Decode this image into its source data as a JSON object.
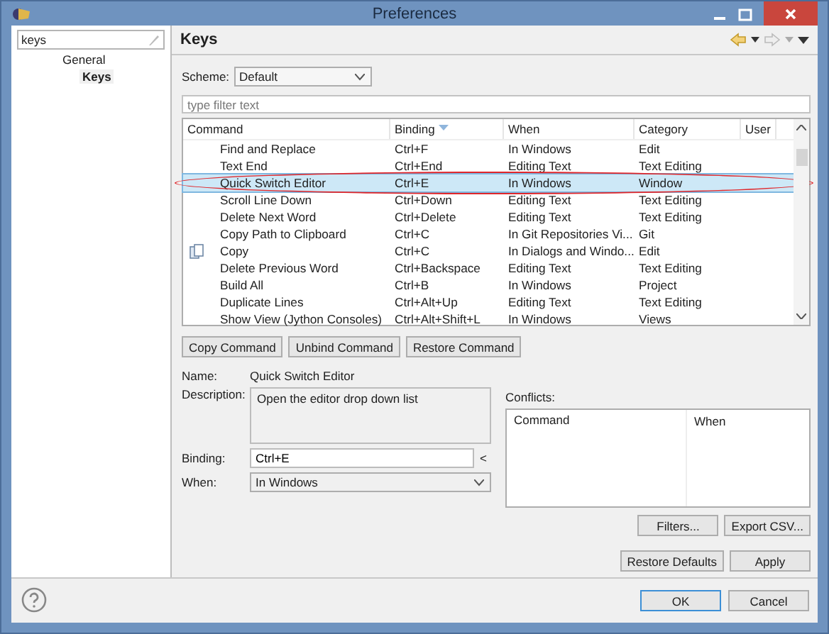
{
  "window": {
    "title": "Preferences"
  },
  "sidebar": {
    "filter": {
      "value": "keys"
    },
    "items": [
      {
        "label": "General",
        "selected": false,
        "children": [
          {
            "label": "Keys",
            "selected": true
          }
        ]
      }
    ]
  },
  "page": {
    "title": "Keys"
  },
  "scheme": {
    "label": "Scheme:",
    "value": "Default"
  },
  "filter": {
    "placeholder": "type filter text"
  },
  "table": {
    "columns": [
      "Command",
      "Binding",
      "When",
      "Category",
      "User"
    ],
    "rows": [
      {
        "kind": "plain",
        "selected": false,
        "circled": false,
        "cells": [
          "Find and Replace",
          "Ctrl+F",
          "In Windows",
          "Edit",
          ""
        ]
      },
      {
        "kind": "plain",
        "selected": false,
        "circled": false,
        "cells": [
          "Text End",
          "Ctrl+End",
          "Editing Text",
          "Text Editing",
          ""
        ]
      },
      {
        "kind": "plain",
        "selected": true,
        "circled": true,
        "cells": [
          "Quick Switch Editor",
          "Ctrl+E",
          "In Windows",
          "Window",
          ""
        ]
      },
      {
        "kind": "plain",
        "selected": false,
        "circled": false,
        "cells": [
          "Scroll Line Down",
          "Ctrl+Down",
          "Editing Text",
          "Text Editing",
          ""
        ]
      },
      {
        "kind": "plain",
        "selected": false,
        "circled": false,
        "cells": [
          "Delete Next Word",
          "Ctrl+Delete",
          "Editing Text",
          "Text Editing",
          ""
        ]
      },
      {
        "kind": "plain",
        "selected": false,
        "circled": false,
        "cells": [
          "Copy Path to Clipboard",
          "Ctrl+C",
          "In Git Repositories Vi...",
          "Git",
          ""
        ]
      },
      {
        "kind": "with-icon",
        "selected": false,
        "circled": false,
        "cells": [
          "Copy",
          "Ctrl+C",
          "In Dialogs and Windo...",
          "Edit",
          ""
        ]
      },
      {
        "kind": "plain",
        "selected": false,
        "circled": false,
        "cells": [
          "Delete Previous Word",
          "Ctrl+Backspace",
          "Editing Text",
          "Text Editing",
          ""
        ]
      },
      {
        "kind": "plain",
        "selected": false,
        "circled": false,
        "cells": [
          "Build All",
          "Ctrl+B",
          "In Windows",
          "Project",
          ""
        ]
      },
      {
        "kind": "plain",
        "selected": false,
        "circled": false,
        "cells": [
          "Duplicate Lines",
          "Ctrl+Alt+Up",
          "Editing Text",
          "Text Editing",
          ""
        ]
      },
      {
        "kind": "plain",
        "selected": false,
        "circled": false,
        "cells": [
          "Show View (Jython Consoles)",
          "Ctrl+Alt+Shift+L",
          "In Windows",
          "Views",
          ""
        ]
      }
    ]
  },
  "command_buttons": [
    "Copy Command",
    "Unbind Command",
    "Restore Command"
  ],
  "details": {
    "name_label": "Name:",
    "name": "Quick Switch Editor",
    "description_label": "Description:",
    "description": "Open the editor drop down list",
    "binding_label": "Binding:",
    "binding": "Ctrl+E",
    "binding_menu": "<",
    "when_label": "When:",
    "when": "In Windows"
  },
  "conflicts": {
    "label": "Conflicts:",
    "columns": [
      "Command",
      "When"
    ]
  },
  "side_buttons": [
    "Filters...",
    "Export CSV..."
  ],
  "page_buttons": [
    "Restore Defaults",
    "Apply"
  ],
  "dialog_buttons": [
    "OK",
    "Cancel"
  ]
}
